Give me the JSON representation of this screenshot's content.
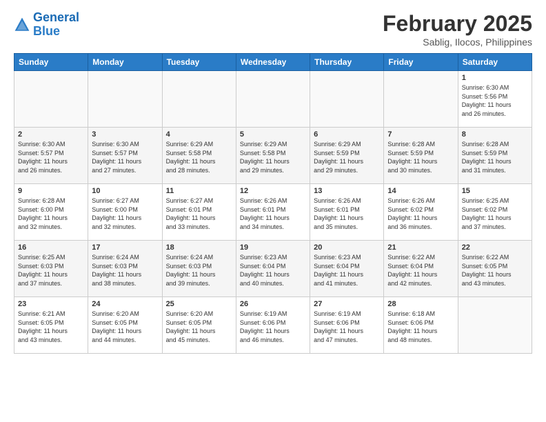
{
  "header": {
    "logo_line1": "General",
    "logo_line2": "Blue",
    "month_year": "February 2025",
    "location": "Sablig, Ilocos, Philippines"
  },
  "weekdays": [
    "Sunday",
    "Monday",
    "Tuesday",
    "Wednesday",
    "Thursday",
    "Friday",
    "Saturday"
  ],
  "weeks": [
    [
      {
        "day": "",
        "info": ""
      },
      {
        "day": "",
        "info": ""
      },
      {
        "day": "",
        "info": ""
      },
      {
        "day": "",
        "info": ""
      },
      {
        "day": "",
        "info": ""
      },
      {
        "day": "",
        "info": ""
      },
      {
        "day": "1",
        "info": "Sunrise: 6:30 AM\nSunset: 5:56 PM\nDaylight: 11 hours\nand 26 minutes."
      }
    ],
    [
      {
        "day": "2",
        "info": "Sunrise: 6:30 AM\nSunset: 5:57 PM\nDaylight: 11 hours\nand 26 minutes."
      },
      {
        "day": "3",
        "info": "Sunrise: 6:30 AM\nSunset: 5:57 PM\nDaylight: 11 hours\nand 27 minutes."
      },
      {
        "day": "4",
        "info": "Sunrise: 6:29 AM\nSunset: 5:58 PM\nDaylight: 11 hours\nand 28 minutes."
      },
      {
        "day": "5",
        "info": "Sunrise: 6:29 AM\nSunset: 5:58 PM\nDaylight: 11 hours\nand 29 minutes."
      },
      {
        "day": "6",
        "info": "Sunrise: 6:29 AM\nSunset: 5:59 PM\nDaylight: 11 hours\nand 29 minutes."
      },
      {
        "day": "7",
        "info": "Sunrise: 6:28 AM\nSunset: 5:59 PM\nDaylight: 11 hours\nand 30 minutes."
      },
      {
        "day": "8",
        "info": "Sunrise: 6:28 AM\nSunset: 5:59 PM\nDaylight: 11 hours\nand 31 minutes."
      }
    ],
    [
      {
        "day": "9",
        "info": "Sunrise: 6:28 AM\nSunset: 6:00 PM\nDaylight: 11 hours\nand 32 minutes."
      },
      {
        "day": "10",
        "info": "Sunrise: 6:27 AM\nSunset: 6:00 PM\nDaylight: 11 hours\nand 32 minutes."
      },
      {
        "day": "11",
        "info": "Sunrise: 6:27 AM\nSunset: 6:01 PM\nDaylight: 11 hours\nand 33 minutes."
      },
      {
        "day": "12",
        "info": "Sunrise: 6:26 AM\nSunset: 6:01 PM\nDaylight: 11 hours\nand 34 minutes."
      },
      {
        "day": "13",
        "info": "Sunrise: 6:26 AM\nSunset: 6:01 PM\nDaylight: 11 hours\nand 35 minutes."
      },
      {
        "day": "14",
        "info": "Sunrise: 6:26 AM\nSunset: 6:02 PM\nDaylight: 11 hours\nand 36 minutes."
      },
      {
        "day": "15",
        "info": "Sunrise: 6:25 AM\nSunset: 6:02 PM\nDaylight: 11 hours\nand 37 minutes."
      }
    ],
    [
      {
        "day": "16",
        "info": "Sunrise: 6:25 AM\nSunset: 6:03 PM\nDaylight: 11 hours\nand 37 minutes."
      },
      {
        "day": "17",
        "info": "Sunrise: 6:24 AM\nSunset: 6:03 PM\nDaylight: 11 hours\nand 38 minutes."
      },
      {
        "day": "18",
        "info": "Sunrise: 6:24 AM\nSunset: 6:03 PM\nDaylight: 11 hours\nand 39 minutes."
      },
      {
        "day": "19",
        "info": "Sunrise: 6:23 AM\nSunset: 6:04 PM\nDaylight: 11 hours\nand 40 minutes."
      },
      {
        "day": "20",
        "info": "Sunrise: 6:23 AM\nSunset: 6:04 PM\nDaylight: 11 hours\nand 41 minutes."
      },
      {
        "day": "21",
        "info": "Sunrise: 6:22 AM\nSunset: 6:04 PM\nDaylight: 11 hours\nand 42 minutes."
      },
      {
        "day": "22",
        "info": "Sunrise: 6:22 AM\nSunset: 6:05 PM\nDaylight: 11 hours\nand 43 minutes."
      }
    ],
    [
      {
        "day": "23",
        "info": "Sunrise: 6:21 AM\nSunset: 6:05 PM\nDaylight: 11 hours\nand 43 minutes."
      },
      {
        "day": "24",
        "info": "Sunrise: 6:20 AM\nSunset: 6:05 PM\nDaylight: 11 hours\nand 44 minutes."
      },
      {
        "day": "25",
        "info": "Sunrise: 6:20 AM\nSunset: 6:05 PM\nDaylight: 11 hours\nand 45 minutes."
      },
      {
        "day": "26",
        "info": "Sunrise: 6:19 AM\nSunset: 6:06 PM\nDaylight: 11 hours\nand 46 minutes."
      },
      {
        "day": "27",
        "info": "Sunrise: 6:19 AM\nSunset: 6:06 PM\nDaylight: 11 hours\nand 47 minutes."
      },
      {
        "day": "28",
        "info": "Sunrise: 6:18 AM\nSunset: 6:06 PM\nDaylight: 11 hours\nand 48 minutes."
      },
      {
        "day": "",
        "info": ""
      }
    ]
  ]
}
